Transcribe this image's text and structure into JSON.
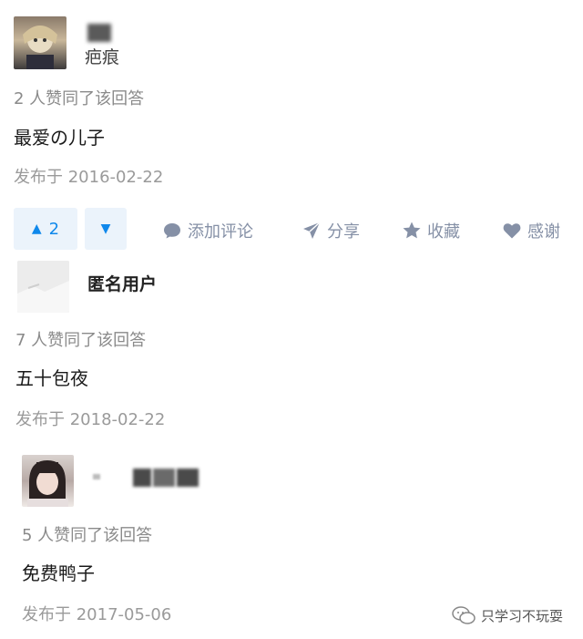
{
  "answers": [
    {
      "author_name": "疤痕",
      "upvote_text": "2 人赞同了该回答",
      "content": "最爱の儿子",
      "date": "发布于 2016-02-22"
    },
    {
      "author_name": "匿名用户",
      "upvote_text": "7 人赞同了该回答",
      "content": "五十包夜",
      "date": "发布于 2018-02-22"
    },
    {
      "author_name": "",
      "upvote_text": "5 人赞同了该回答",
      "content": "免费鸭子",
      "date": "发布于 2017-05-06"
    }
  ],
  "actions": {
    "vote_count": "2",
    "comment": "添加评论",
    "share": "分享",
    "collect": "收藏",
    "thanks": "感谢"
  },
  "colors": {
    "accent": "#0f88eb",
    "vote_bg": "#ebf3fb",
    "action_gray": "#8590a6"
  },
  "watermark": "只学习不玩耍"
}
